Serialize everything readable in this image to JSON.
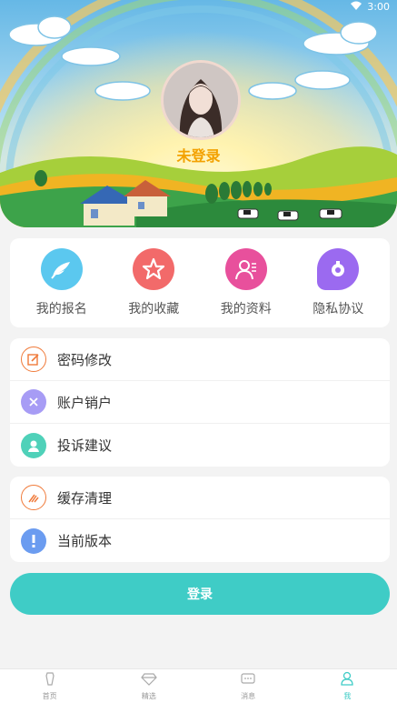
{
  "status": {
    "time": "3:00"
  },
  "profile": {
    "status_text": "未登录"
  },
  "quick_menu": [
    {
      "label": "我的报名",
      "icon": "feather-icon",
      "color": "#5bc8ef"
    },
    {
      "label": "我的收藏",
      "icon": "star-icon",
      "color": "#f26a6a"
    },
    {
      "label": "我的资料",
      "icon": "profile-icon",
      "color": "#e8509c"
    },
    {
      "label": "隐私协议",
      "icon": "privacy-icon",
      "color": "#9b6af0"
    }
  ],
  "settings_group_1": [
    {
      "label": "密码修改",
      "icon": "edit-icon"
    },
    {
      "label": "账户销户",
      "icon": "close-icon"
    },
    {
      "label": "投诉建议",
      "icon": "support-icon"
    }
  ],
  "settings_group_2": [
    {
      "label": "缓存清理",
      "icon": "broom-icon"
    },
    {
      "label": "当前版本",
      "icon": "info-icon"
    }
  ],
  "login_button": {
    "label": "登录",
    "color": "#3fccc6"
  },
  "tabbar": [
    {
      "label": "首页",
      "icon": "home-icon",
      "active": false
    },
    {
      "label": "精选",
      "icon": "diamond-icon",
      "active": false
    },
    {
      "label": "消息",
      "icon": "message-icon",
      "active": false
    },
    {
      "label": "我",
      "icon": "user-icon",
      "active": true
    }
  ]
}
